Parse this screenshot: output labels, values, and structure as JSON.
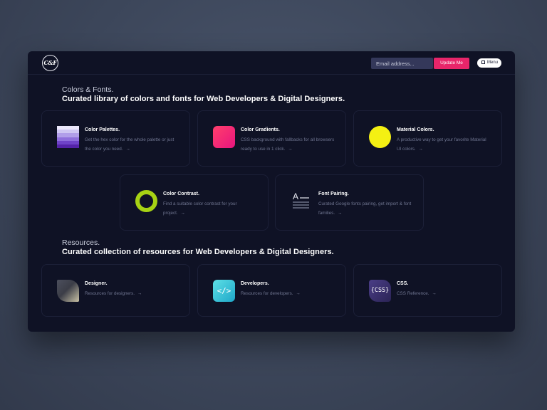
{
  "header": {
    "logo_text": "C&F",
    "email_placeholder": "Email address...",
    "update_button": "Update Me",
    "menu_label": "Menu"
  },
  "colors_fonts": {
    "label": "Colors & Fonts.",
    "title": "Curated library of colors and fonts for Web Developers & Digital Designers.",
    "cards": [
      {
        "title": "Color Palettes.",
        "desc": "Get the hex color for the whole palette or just the color you need.",
        "icon": "color-palette-icon"
      },
      {
        "title": "Color Gradients.",
        "desc": "CSS background with fallbacks for all browsers ready to use in 1 click.",
        "icon": "gradient-icon"
      },
      {
        "title": "Material Colors.",
        "desc": "A productive way to get your favorite Material UI colors.",
        "icon": "material-circle-icon"
      },
      {
        "title": "Color Contrast.",
        "desc": "Find a suitable color contrast for your project.",
        "icon": "contrast-ring-icon"
      },
      {
        "title": "Font Pairing.",
        "desc": "Curated Google fonts pairing, get import & font families.",
        "icon": "font-pairing-icon"
      }
    ]
  },
  "resources": {
    "label": "Resources.",
    "title": "Curated collection of resources for Web Developers & Digital Designers.",
    "cards": [
      {
        "title": "Designer.",
        "desc": "Resources for designers.",
        "icon": "designer-icon"
      },
      {
        "title": "Developers.",
        "desc": "Resources for developers.",
        "icon": "code-icon",
        "icon_text": "</>"
      },
      {
        "title": "CSS.",
        "desc": "CSS Reference.",
        "icon": "css-icon",
        "icon_text": "{CSS}"
      }
    ]
  },
  "icons": {
    "arrow": "→",
    "font_letter": "A"
  },
  "colors": {
    "background": "#3c465a",
    "window": "#0f1225",
    "accent_pink": "#e8256a",
    "material_yellow": "#f4f013",
    "contrast_green": "#a7d214",
    "palette_shades": [
      "#ebe8fb",
      "#cfc6f3",
      "#b19ee9",
      "#8f6fdc",
      "#6f43c8",
      "#5423a8"
    ]
  }
}
